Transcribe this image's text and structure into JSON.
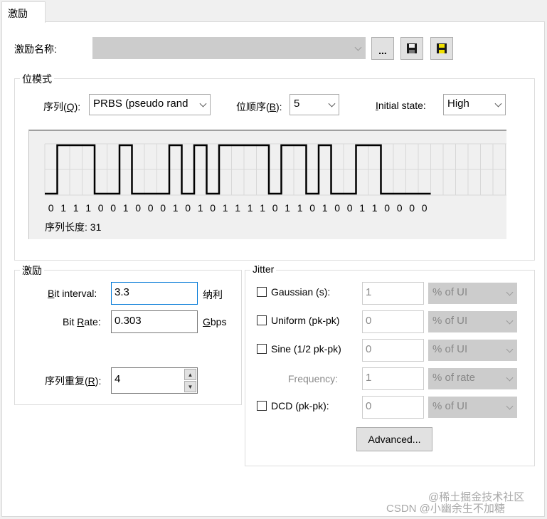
{
  "tab": {
    "label": "激励"
  },
  "stimulus_name": {
    "label": "激励名称:",
    "value": "",
    "browse_label": "..."
  },
  "bit_pattern": {
    "title": "位模式",
    "sequence_label_pre": "序列(",
    "sequence_label_key": "Q",
    "sequence_label_post": "):",
    "sequence_value": "PRBS (pseudo rand",
    "order_label_pre": "位顺序(",
    "order_label_key": "B",
    "order_label_post": "):",
    "order_value": "5",
    "initial_label_key": "I",
    "initial_label_rest": "nitial state:",
    "initial_value": "High",
    "bits": [
      "0",
      "1",
      "1",
      "1",
      "0",
      "0",
      "1",
      "0",
      "0",
      "0",
      "1",
      "0",
      "1",
      "0",
      "1",
      "1",
      "1",
      "1",
      "0",
      "1",
      "1",
      "0",
      "1",
      "0",
      "0",
      "1",
      "1",
      "0",
      "0",
      "0",
      "0"
    ],
    "length_label": "序列长度: 31"
  },
  "stimulus": {
    "title": "激励",
    "bit_interval_key": "B",
    "bit_interval_rest": "it interval:",
    "bit_interval_value": "3.3",
    "bit_interval_unit": "纳利",
    "bit_rate_pre": "Bit ",
    "bit_rate_key": "R",
    "bit_rate_rest": "ate:",
    "bit_rate_value": "0.303",
    "bit_rate_unit_key": "G",
    "bit_rate_unit_rest": "bps",
    "repeat_label_pre": "序列重复(",
    "repeat_label_key": "R",
    "repeat_label_post": "):",
    "repeat_value": "4"
  },
  "jitter": {
    "title": "Jitter",
    "gaussian_label": "Gaussian (s):",
    "gaussian_value": "1",
    "gaussian_unit": "% of UI",
    "uniform_label": "Uniform (pk-pk)",
    "uniform_value": "0",
    "uniform_unit": "% of UI",
    "sine_label": "Sine (1/2 pk-pk)",
    "sine_value": "0",
    "sine_unit": "% of UI",
    "frequency_label": "Frequency:",
    "frequency_value": "1",
    "frequency_unit": "% of rate",
    "dcd_label": "DCD (pk-pk):",
    "dcd_value": "0",
    "dcd_unit": "% of UI",
    "advanced_label": "Advanced..."
  },
  "watermark": {
    "text1": "@稀土掘金技术社区",
    "text2": "CSDN @小幽余生不加糖"
  }
}
